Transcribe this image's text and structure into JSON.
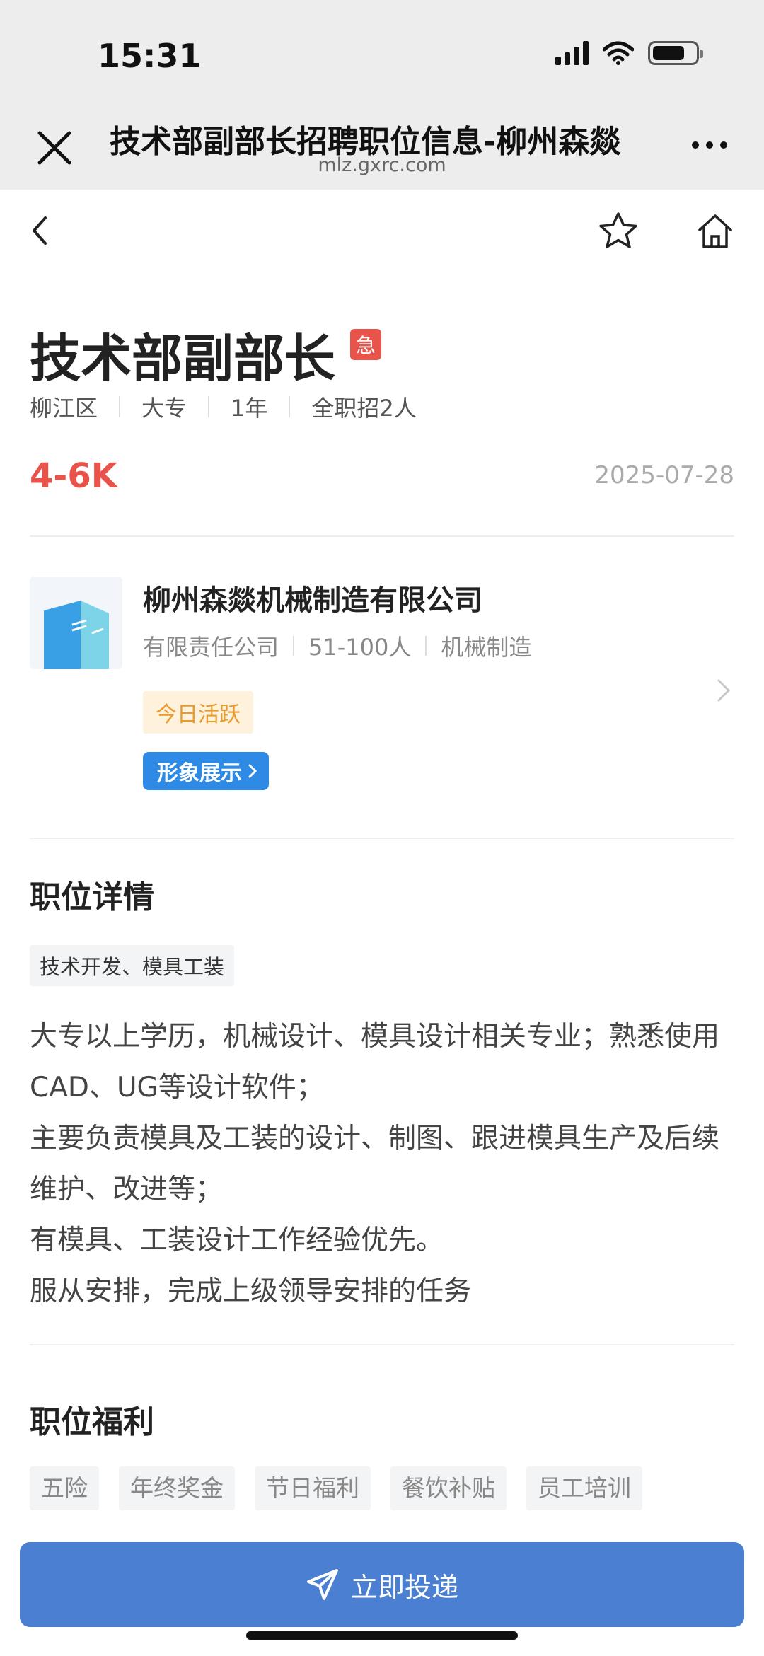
{
  "status_bar": {
    "time": "15:31"
  },
  "browser": {
    "title": "技术部副部长招聘职位信息-柳州森燚",
    "domain": "mlz.gxrc.com"
  },
  "job": {
    "title": "技术部副部长",
    "urgent_badge": "急",
    "meta": [
      "柳江区",
      "大专",
      "1年",
      "全职招2人"
    ],
    "salary": "4-6K",
    "date": "2025-07-28"
  },
  "company": {
    "name": "柳州森燚机械制造有限公司",
    "meta": [
      "有限责任公司",
      "51-100人",
      "机械制造"
    ],
    "active_badge": "今日活跃",
    "showcase_label": "形象展示"
  },
  "details": {
    "title": "职位详情",
    "category": "技术开发、模具工装",
    "lines": [
      "大专以上学历，机械设计、模具设计相关专业；熟悉使用CAD、UG等设计软件；",
      "主要负责模具及工装的设计、制图、跟进模具生产及后续维护、改进等；",
      "有模具、工装设计工作经验优先。",
      "服从安排，完成上级领导安排的任务"
    ]
  },
  "benefits": {
    "title": "职位福利",
    "items": [
      "五险",
      "年终奖金",
      "节日福利",
      "餐饮补贴",
      "员工培训"
    ]
  },
  "apply_button": {
    "label": "立即投递"
  },
  "colors": {
    "accent": "#e8534a",
    "primary": "#4b7fd1",
    "showcase": "#2f8ae6"
  }
}
